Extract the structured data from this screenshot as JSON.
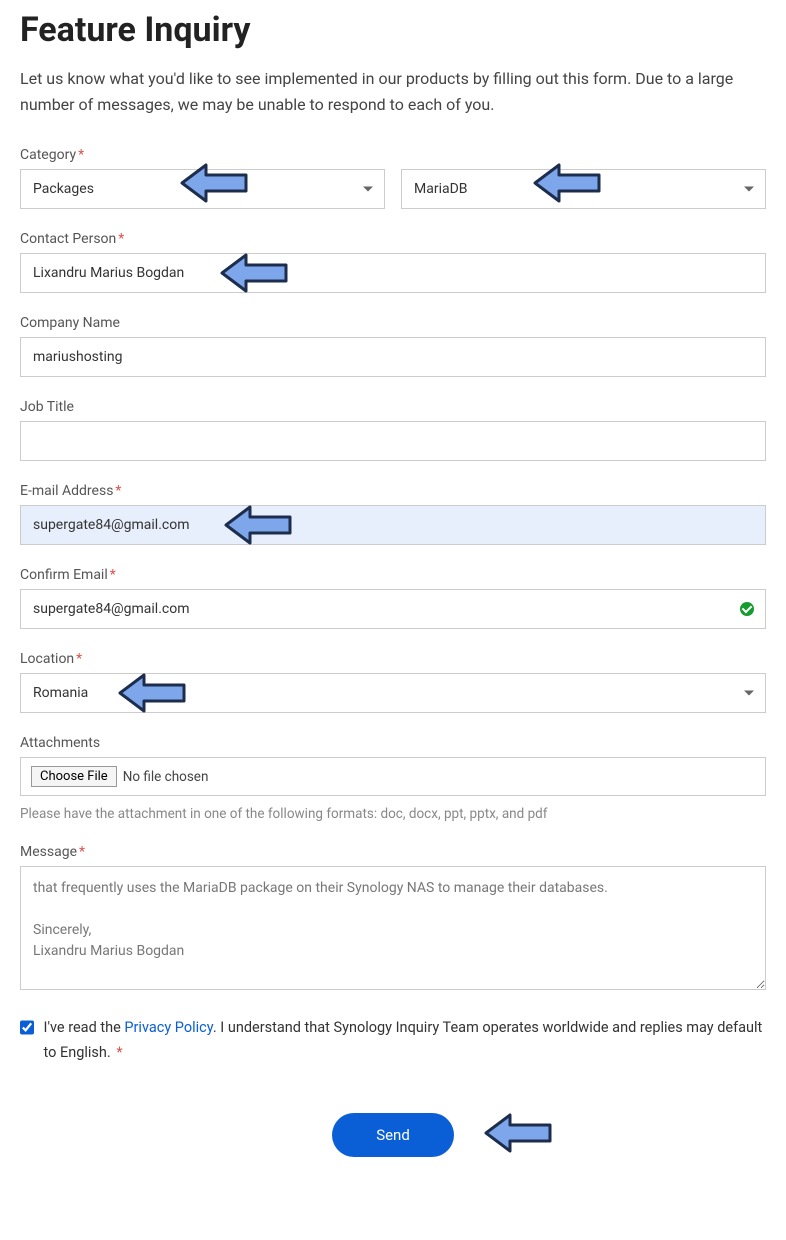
{
  "page": {
    "title": "Feature Inquiry",
    "intro": "Let us know what you'd like to see implemented in our products by filling out this form. Due to a large number of messages, we may be unable to respond to each of you."
  },
  "form": {
    "category_label": "Category",
    "category_value": "Packages",
    "subcategory_value": "MariaDB",
    "contact_label": "Contact Person",
    "contact_value": "Lixandru Marius Bogdan",
    "company_label": "Company Name",
    "company_value": "mariushosting",
    "jobtitle_label": "Job Title",
    "jobtitle_value": "",
    "email_label": "E-mail Address",
    "email_value": "supergate84@gmail.com",
    "confirm_label": "Confirm Email",
    "confirm_value": "supergate84@gmail.com",
    "location_label": "Location",
    "location_value": "Romania",
    "attachments_label": "Attachments",
    "choosefile_label": "Choose File",
    "file_status": "No file chosen",
    "attachments_helper": "Please have the attachment in one of the following formats: doc, docx, ppt, pptx, and pdf",
    "message_label": "Message",
    "message_value": "that frequently uses the MariaDB package on their Synology NAS to manage their databases.\n\nSincerely,\nLixandru Marius Bogdan",
    "consent_pre": "I've read the ",
    "consent_link": "Privacy Policy",
    "consent_post": ". I understand that Synology Inquiry Team operates worldwide and replies may default to English.",
    "send_label": "Send"
  }
}
